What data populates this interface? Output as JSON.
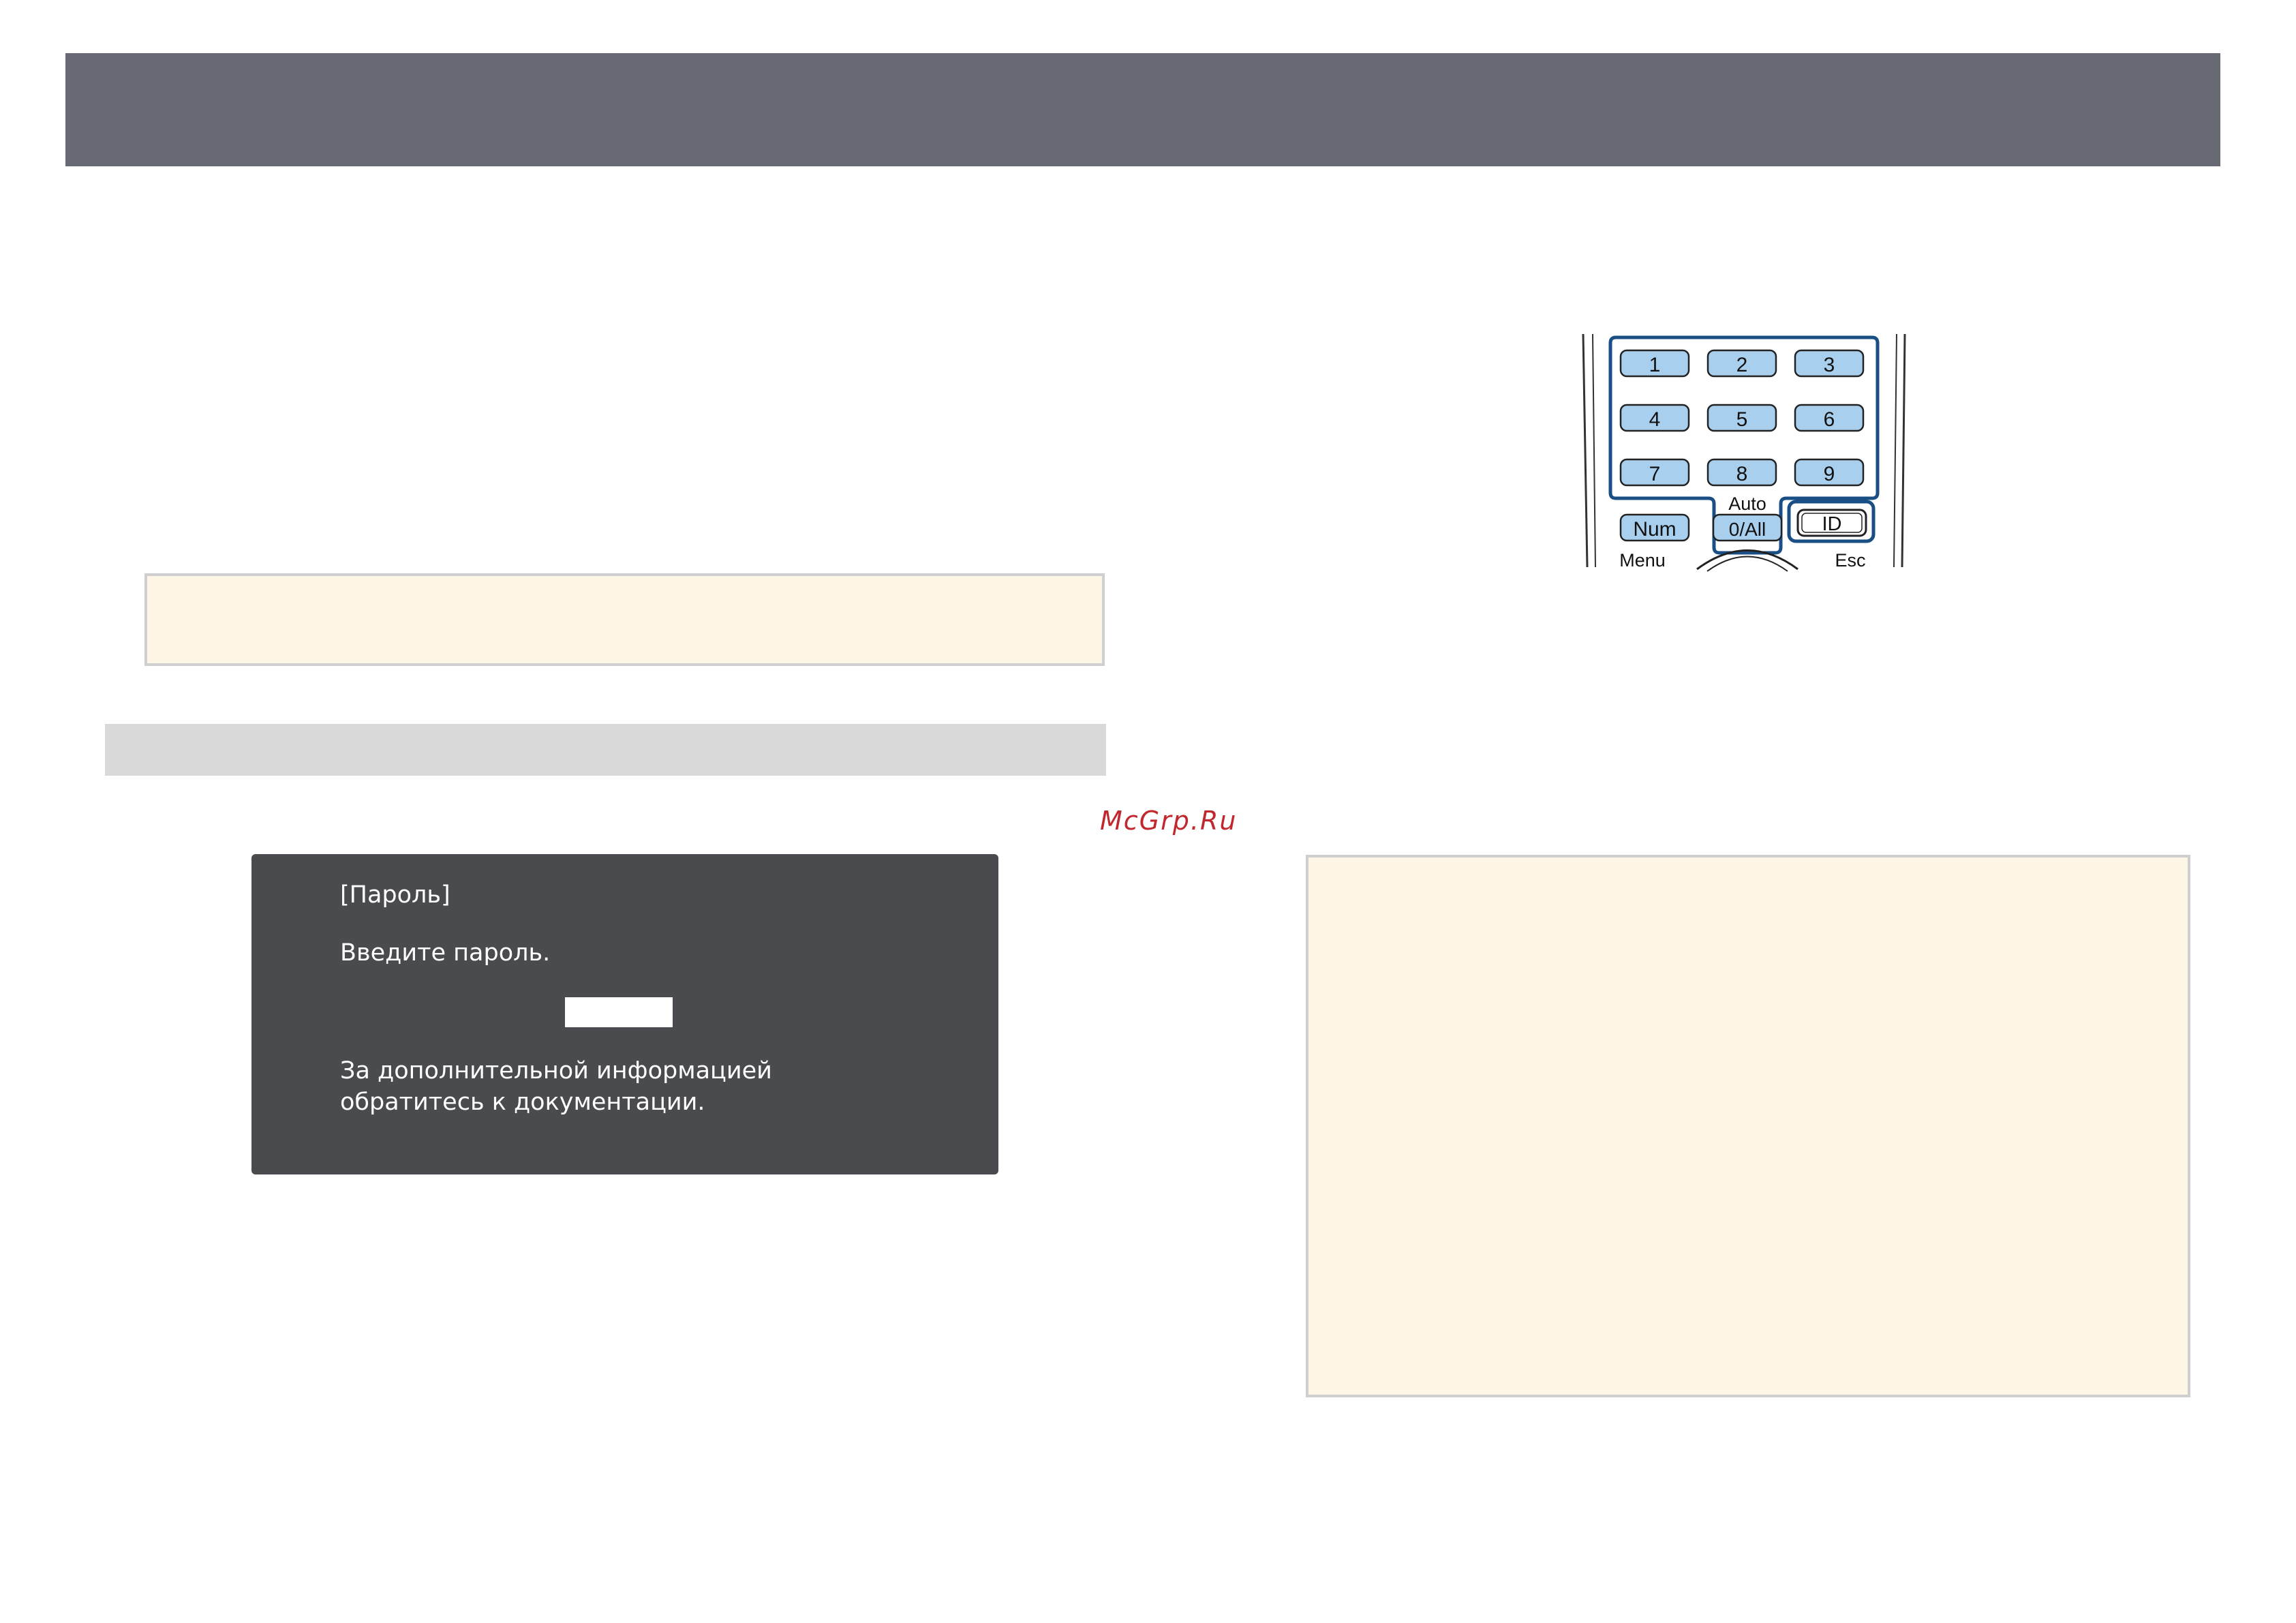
{
  "watermark": "McGrp.Ru",
  "password_screen": {
    "title": "[Пароль]",
    "prompt": "Введите пароль.",
    "input_value": "",
    "info_line_1": "За дополнительной информацией",
    "info_line_2": "обратитесь к документации."
  },
  "remote": {
    "keys": [
      "1",
      "2",
      "3",
      "4",
      "5",
      "6",
      "7",
      "8",
      "9"
    ],
    "num_label": "Num",
    "auto_label": "Auto",
    "zero_all_label": "0/All",
    "id_label": "ID",
    "menu_label": "Menu",
    "esc_label": "Esc"
  },
  "colors": {
    "header": "#686a73",
    "note_background": "#fdf6e6",
    "section_bar": "#d9d9d9",
    "screen_background": "#4a4b4e",
    "key_fill": "#a9cfee",
    "highlight_outline": "#1a4f86",
    "watermark": "#c1272d"
  }
}
